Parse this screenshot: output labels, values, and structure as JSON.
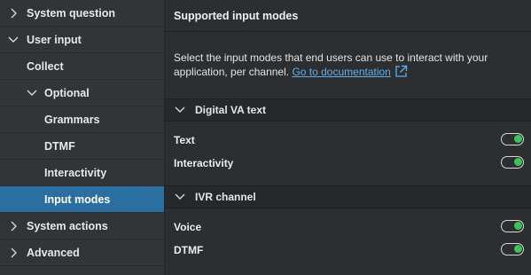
{
  "sidebar": {
    "items": [
      {
        "label": "System question",
        "chevron": "right"
      },
      {
        "label": "User input",
        "chevron": "down"
      },
      {
        "label": "Collect",
        "chevron": ""
      },
      {
        "label": "Optional",
        "chevron": "down"
      },
      {
        "label": "Grammars",
        "chevron": ""
      },
      {
        "label": "DTMF",
        "chevron": ""
      },
      {
        "label": "Interactivity",
        "chevron": ""
      },
      {
        "label": "Input modes",
        "chevron": "",
        "selected": true
      },
      {
        "label": "System actions",
        "chevron": "right"
      },
      {
        "label": "Advanced",
        "chevron": "right"
      }
    ]
  },
  "main": {
    "title": "Supported input modes",
    "description": "Select the input modes that end users can use to interact with your application, per channel.",
    "doc_link": "Go to documentation",
    "sections": [
      {
        "title": "Digital VA text",
        "rows": [
          {
            "label": "Text",
            "enabled": true
          },
          {
            "label": "Interactivity",
            "enabled": true
          }
        ]
      },
      {
        "title": "IVR channel",
        "rows": [
          {
            "label": "Voice",
            "enabled": true
          },
          {
            "label": "DTMF",
            "enabled": true
          }
        ]
      }
    ]
  },
  "colors": {
    "selected_bg": "#2b6ea0",
    "toggle_on": "#3cc35a",
    "link": "#5fb0ee"
  }
}
